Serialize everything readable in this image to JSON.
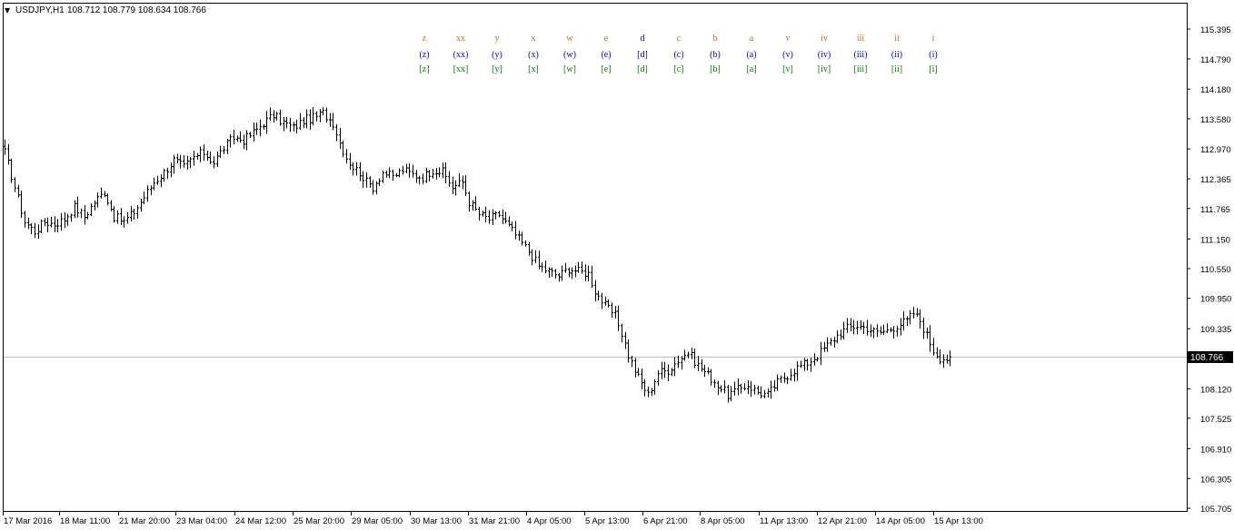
{
  "header": {
    "arrow": "▼",
    "symbol": "USDJPY,H1",
    "ohlc": "108.712 108.779 108.634 108.766"
  },
  "colors": {
    "background": "#ffffff",
    "frame": "#000000",
    "bars": "#000000",
    "price_line": "#c0c0c0",
    "price_tag_bg": "#000000",
    "price_tag_text": "#ffffff",
    "row_orange": "#d2691e",
    "row_blue": "#0000ff",
    "row_green": "#008000",
    "row_navy": "#00008b"
  },
  "wave_labels": {
    "rows": [
      {
        "style": "orange",
        "labels": [
          "z",
          "xx",
          "y",
          "x",
          "w",
          "e",
          "d",
          "c",
          "b",
          "a",
          "v",
          "iv",
          "iii",
          "ii",
          "i"
        ]
      },
      {
        "style": "blue",
        "labels": [
          "(z)",
          "(xx)",
          "(y)",
          "(x)",
          "(w)",
          "(e)",
          "[d]",
          "(c)",
          "(b)",
          "(a)",
          "(v)",
          "(iv)",
          "(iii)",
          "(ii)",
          "(i)"
        ]
      },
      {
        "style": "green",
        "labels": [
          "[z]",
          "[xx]",
          "[y]",
          "[x]",
          "[w]",
          "[e]",
          "[d]",
          "[c]",
          "[b]",
          "[a]",
          "[v]",
          "[iv]",
          "[iii]",
          "[ii]",
          "[i]"
        ]
      }
    ],
    "highlight_col": 6
  },
  "chart_data": {
    "type": "ohlc",
    "symbol": "USDJPY",
    "timeframe": "H1",
    "y_ticks": [
      "115.395",
      "114.790",
      "114.180",
      "113.580",
      "112.970",
      "112.365",
      "111.765",
      "111.150",
      "110.550",
      "109.950",
      "109.335",
      "108.120",
      "107.525",
      "106.910",
      "106.305",
      "105.705"
    ],
    "ylim": [
      105.705,
      115.395
    ],
    "current_price": "108.766",
    "x_ticks": [
      "17 Mar 2016",
      "18 Mar 11:00",
      "21 Mar 20:00",
      "23 Mar 04:00",
      "24 Mar 12:00",
      "25 Mar 20:00",
      "29 Mar 05:00",
      "30 Mar 13:00",
      "31 Mar 21:00",
      "4 Apr 05:00",
      "5 Apr 13:00",
      "6 Apr 21:00",
      "8 Apr 05:00",
      "11 Apr 13:00",
      "12 Apr 21:00",
      "14 Apr 05:00",
      "15 Apr 13:00"
    ],
    "close_anchors": [
      [
        0,
        112.9
      ],
      [
        3,
        112.2
      ],
      [
        6,
        111.5
      ],
      [
        9,
        111.3
      ],
      [
        12,
        111.5
      ],
      [
        15,
        111.45
      ],
      [
        18,
        111.55
      ],
      [
        21,
        111.8
      ],
      [
        24,
        111.6
      ],
      [
        27,
        111.9
      ],
      [
        30,
        112.1
      ],
      [
        33,
        111.6
      ],
      [
        36,
        111.5
      ],
      [
        39,
        111.7
      ],
      [
        42,
        112.0
      ],
      [
        45,
        112.3
      ],
      [
        48,
        112.5
      ],
      [
        51,
        112.75
      ],
      [
        54,
        112.6
      ],
      [
        57,
        112.8
      ],
      [
        60,
        112.9
      ],
      [
        63,
        112.7
      ],
      [
        66,
        113.0
      ],
      [
        69,
        113.2
      ],
      [
        72,
        113.15
      ],
      [
        75,
        113.3
      ],
      [
        78,
        113.5
      ],
      [
        81,
        113.65
      ],
      [
        84,
        113.5
      ],
      [
        87,
        113.4
      ],
      [
        90,
        113.55
      ],
      [
        93,
        113.6
      ],
      [
        96,
        113.7
      ],
      [
        99,
        113.5
      ],
      [
        101,
        113.1
      ],
      [
        103,
        112.8
      ],
      [
        105,
        112.6
      ],
      [
        107,
        112.5
      ],
      [
        109,
        112.3
      ],
      [
        111,
        112.2
      ],
      [
        114,
        112.5
      ],
      [
        117,
        112.4
      ],
      [
        120,
        112.55
      ],
      [
        123,
        112.45
      ],
      [
        126,
        112.4
      ],
      [
        129,
        112.55
      ],
      [
        132,
        112.5
      ],
      [
        135,
        112.2
      ],
      [
        138,
        112.3
      ],
      [
        140,
        111.9
      ],
      [
        143,
        111.65
      ],
      [
        146,
        111.55
      ],
      [
        149,
        111.65
      ],
      [
        152,
        111.4
      ],
      [
        155,
        111.15
      ],
      [
        158,
        110.9
      ],
      [
        161,
        110.6
      ],
      [
        164,
        110.5
      ],
      [
        167,
        110.4
      ],
      [
        170,
        110.55
      ],
      [
        173,
        110.5
      ],
      [
        176,
        110.45
      ],
      [
        178,
        110.1
      ],
      [
        181,
        109.8
      ],
      [
        184,
        109.6
      ],
      [
        186,
        109.25
      ],
      [
        188,
        108.8
      ],
      [
        191,
        108.35
      ],
      [
        194,
        108.0
      ],
      [
        197,
        108.45
      ],
      [
        200,
        108.5
      ],
      [
        203,
        108.7
      ],
      [
        206,
        108.85
      ],
      [
        209,
        108.6
      ],
      [
        212,
        108.4
      ],
      [
        215,
        108.2
      ],
      [
        218,
        108.0
      ],
      [
        221,
        108.1
      ],
      [
        224,
        108.2
      ],
      [
        227,
        108.05
      ],
      [
        230,
        108.0
      ],
      [
        233,
        108.25
      ],
      [
        236,
        108.4
      ],
      [
        239,
        108.55
      ],
      [
        242,
        108.65
      ],
      [
        245,
        108.8
      ],
      [
        248,
        109.0
      ],
      [
        251,
        109.2
      ],
      [
        254,
        109.35
      ],
      [
        257,
        109.4
      ],
      [
        260,
        109.35
      ],
      [
        263,
        109.25
      ],
      [
        266,
        109.3
      ],
      [
        269,
        109.4
      ],
      [
        272,
        109.5
      ],
      [
        274,
        109.65
      ],
      [
        276,
        109.5
      ],
      [
        278,
        109.2
      ],
      [
        280,
        108.9
      ],
      [
        282,
        108.75
      ],
      [
        284,
        108.73
      ],
      [
        285,
        108.766
      ]
    ]
  }
}
